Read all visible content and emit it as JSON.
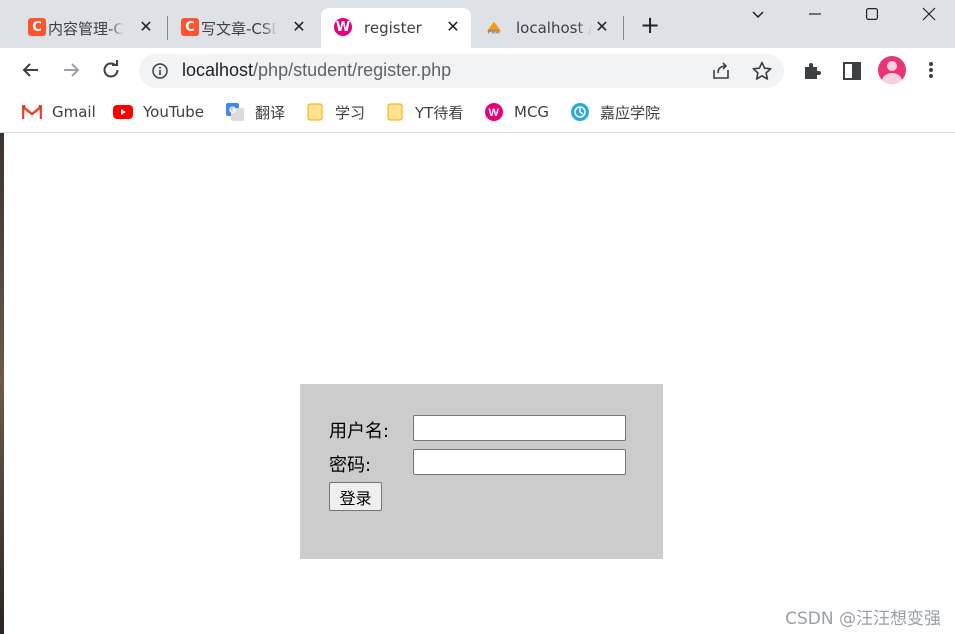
{
  "tabs": [
    {
      "title": "内容管理-CSDN",
      "icon": "csdn-icon",
      "icon_color": "#fc5531",
      "active": false
    },
    {
      "title": "写文章-CSDN",
      "icon": "csdn-icon",
      "icon_color": "#fc5531",
      "active": false
    },
    {
      "title": "register",
      "icon": "wamp-icon",
      "icon_color": "#e6007e",
      "active": true
    },
    {
      "title": "localhost / ",
      "icon": "phpmyadmin-icon",
      "icon_color": "#f89c0e",
      "active": false
    }
  ],
  "address_bar": {
    "host": "localhost",
    "path": "/php/student/register.php"
  },
  "bookmarks": [
    {
      "label": "Gmail",
      "icon": "gmail-icon"
    },
    {
      "label": "YouTube",
      "icon": "youtube-icon"
    },
    {
      "label": "翻译",
      "icon": "translate-icon"
    },
    {
      "label": "学习",
      "icon": "folder-icon"
    },
    {
      "label": "YT待看",
      "icon": "folder-icon"
    },
    {
      "label": "MCG",
      "icon": "wamp-icon"
    },
    {
      "label": "嘉应学院",
      "icon": "school-icon"
    }
  ],
  "form": {
    "username_label": "用户名:",
    "password_label": "密码:",
    "username_value": "",
    "password_value": "",
    "submit_label": "登录"
  },
  "watermark": "CSDN @汪汪想变强",
  "colors": {
    "tabstrip_bg": "#dee1e6",
    "form_bg": "#cccccc",
    "csdn_orange": "#fc5531",
    "wamp_pink": "#e6007e",
    "avatar_pink": "#e8357a"
  }
}
